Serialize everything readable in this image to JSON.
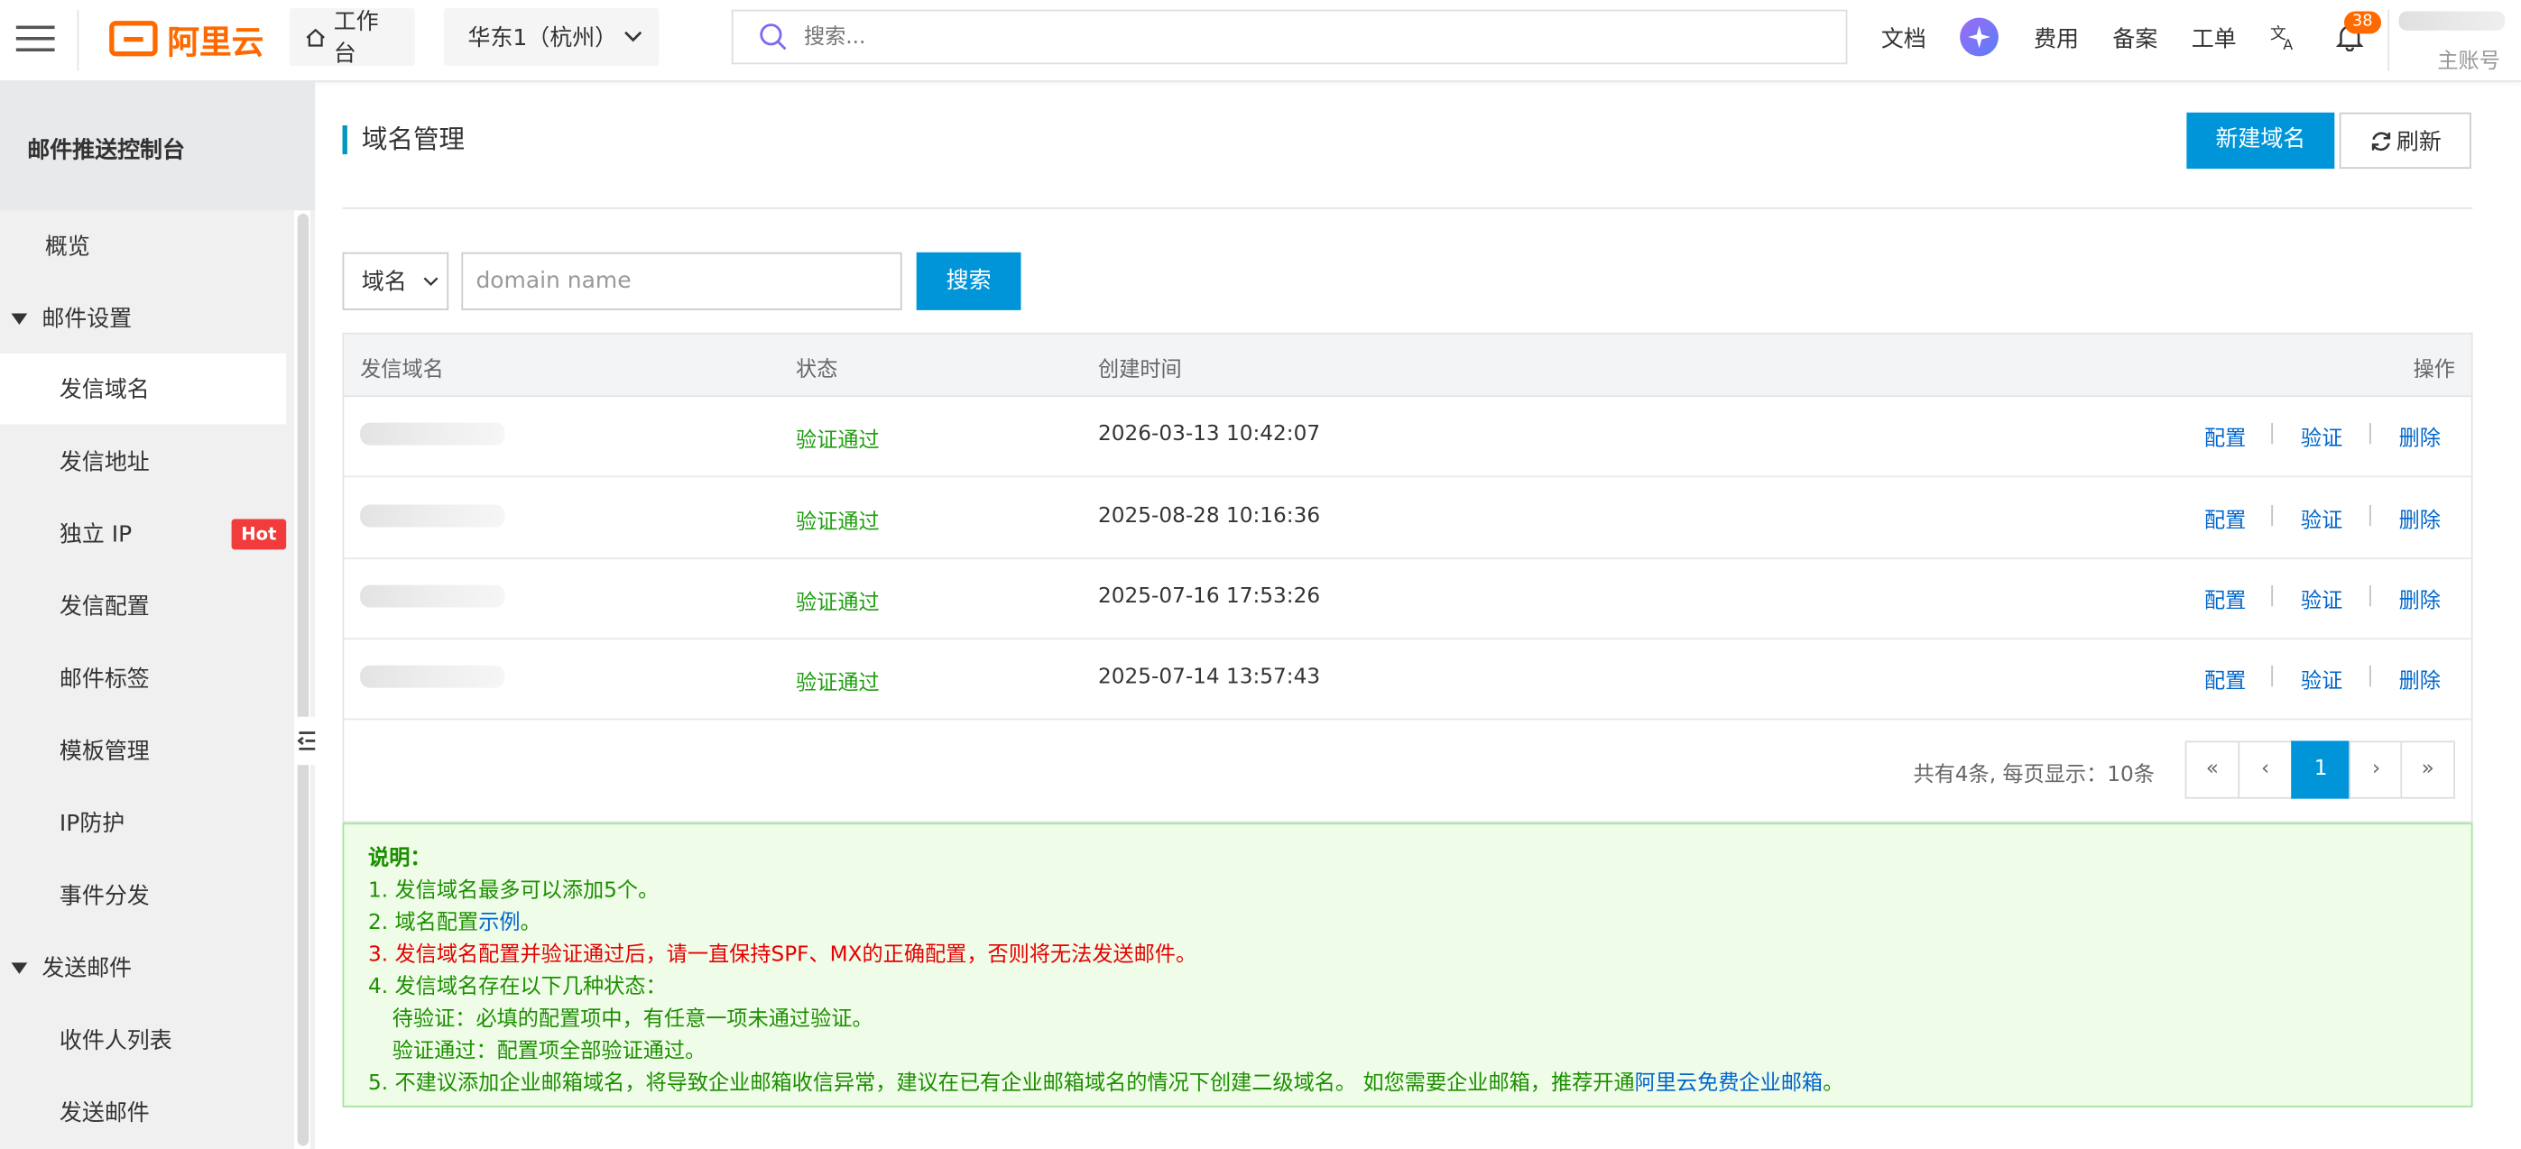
{
  "topbar": {
    "logo_text": "阿里云",
    "workbench": "工作台",
    "region": "华东1（杭州）",
    "search_placeholder": "搜索...",
    "links": [
      "文档",
      "费用",
      "备案",
      "工单"
    ],
    "notification_count": "38",
    "account_label": "主账号",
    "brand_color": "#ff6a00"
  },
  "sidebar": {
    "title": "邮件推送控制台",
    "items": {
      "overview": "概览",
      "group_mail_settings": "邮件设置",
      "sender_domain": "发信域名",
      "sender_address": "发信地址",
      "dedicated_ip": "独立 IP",
      "hot_badge": "Hot",
      "send_config": "发信配置",
      "mail_tags": "邮件标签",
      "templates": "模板管理",
      "ip_protection": "IP防护",
      "event_dispatch": "事件分发",
      "group_send_mail": "发送邮件",
      "recipient_list": "收件人列表",
      "send_mail": "发送邮件"
    }
  },
  "main": {
    "title": "域名管理",
    "new_domain_button": "新建域名",
    "refresh_button": "刷新",
    "filter": {
      "field_select": "域名",
      "input_placeholder": "domain name",
      "search_button": "搜索"
    },
    "table": {
      "columns": [
        "发信域名",
        "状态",
        "创建时间",
        "操作"
      ],
      "rows": [
        {
          "status": "验证通过",
          "created": "2026-03-13 10:42:07"
        },
        {
          "status": "验证通过",
          "created": "2025-08-28 10:16:36"
        },
        {
          "status": "验证通过",
          "created": "2025-07-16 17:53:26"
        },
        {
          "status": "验证通过",
          "created": "2025-07-14 13:57:43"
        }
      ],
      "actions": {
        "config": "配置",
        "verify": "验证",
        "delete": "删除",
        "separator": "|"
      }
    },
    "pagination": {
      "info": "共有4条, 每页显示：10条",
      "first": "«",
      "prev": "‹",
      "current": "1",
      "next": "›",
      "last": "»"
    },
    "notes": {
      "title": "说明：",
      "line1": "1. 发信域名最多可以添加5个。",
      "line2_prefix": "2. 域名配置",
      "line2_link": "示例",
      "line2_suffix": "。",
      "line3": "3. 发信域名配置并验证通过后，请一直保持SPF、MX的正确配置，否则将无法发送邮件。",
      "line4": "4. 发信域名存在以下几种状态：",
      "line4a": "待验证：必填的配置项中，有任意一项未通过验证。",
      "line4b": "验证通过：配置项全部验证通过。",
      "line5_prefix": "5. 不建议添加企业邮箱域名，将导致企业邮箱收信异常，建议在已有企业邮箱域名的情况下创建二级域名。 如您需要企业邮箱，推荐开通",
      "line5_link": "阿里云免费企业邮箱",
      "line5_suffix": "。"
    }
  }
}
